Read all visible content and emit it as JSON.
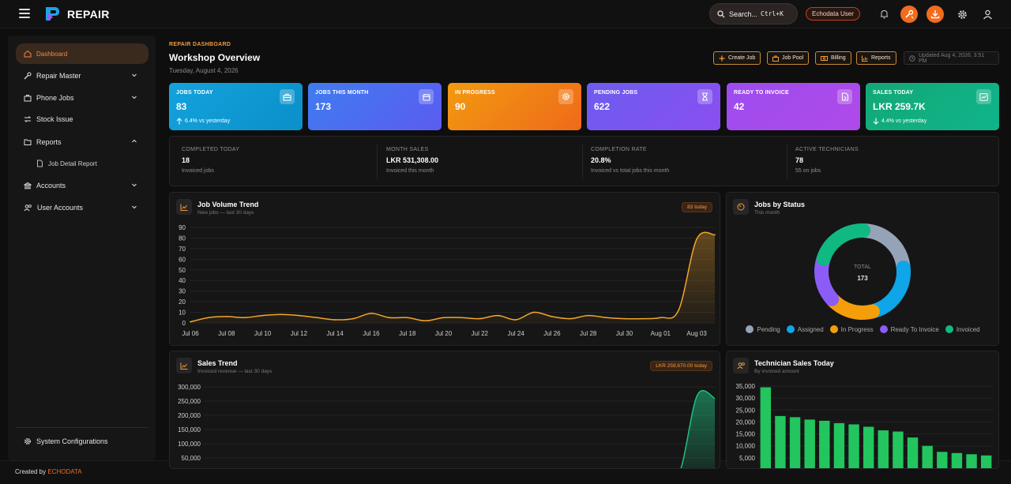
{
  "app": {
    "brand": "REPAIR"
  },
  "topbar": {
    "search_label": "Search...",
    "search_shortcut": "Ctrl+K",
    "user": "Echodata User"
  },
  "sidebar": {
    "items": [
      {
        "label": "Dashboard",
        "icon": "home-icon",
        "active": true
      },
      {
        "label": "Repair Master",
        "icon": "wrench-icon",
        "chevron": "down"
      },
      {
        "label": "Phone Jobs",
        "icon": "briefcase-icon",
        "chevron": "down"
      },
      {
        "label": "Stock Issue",
        "icon": "swap-icon"
      },
      {
        "label": "Reports",
        "icon": "folder-icon",
        "chevron": "up"
      },
      {
        "label": "Job Detail Report",
        "icon": "document-icon",
        "sub": true
      },
      {
        "label": "Accounts",
        "icon": "bank-icon",
        "chevron": "down"
      },
      {
        "label": "User Accounts",
        "icon": "users-icon",
        "chevron": "down"
      }
    ],
    "footer_item": {
      "label": "System Configurations",
      "icon": "gear-icon"
    }
  },
  "footer": {
    "prefix": "Created by",
    "company": "ECHODATA"
  },
  "header": {
    "eyebrow": "REPAIR DASHBOARD",
    "title": "Workshop Overview",
    "date": "Tuesday, August 4, 2026",
    "actions": [
      {
        "label": "Create Job",
        "icon": "plus-icon"
      },
      {
        "label": "Job Pool",
        "icon": "briefcase-icon"
      },
      {
        "label": "Billing",
        "icon": "cash-icon"
      },
      {
        "label": "Reports",
        "icon": "bar-chart-icon"
      }
    ],
    "updated": "Updated Aug 4, 2026, 3:51 PM"
  },
  "kpis": [
    {
      "label": "JOBS TODAY",
      "value": "83",
      "sub": "6.4% vs yesterday",
      "trend": "up",
      "icon": "briefcase-icon",
      "color_from": "#13a3dd",
      "color_to": "#0b8fc8"
    },
    {
      "label": "JOBS THIS MONTH",
      "value": "173",
      "sub": "",
      "icon": "calendar-icon",
      "color_from": "#3f7cf0",
      "color_to": "#5b5cf0"
    },
    {
      "label": "IN PROGRESS",
      "value": "90",
      "sub": "",
      "icon": "gear-icon",
      "color_from": "#f29a10",
      "color_to": "#ef6a1a"
    },
    {
      "label": "PENDING JOBS",
      "value": "622",
      "sub": "",
      "icon": "hourglass-icon",
      "color_from": "#6c5cf0",
      "color_to": "#8a4ff0"
    },
    {
      "label": "READY TO INVOICE",
      "value": "42",
      "sub": "",
      "icon": "invoice-icon",
      "color_from": "#9c4cf0",
      "color_to": "#b04ae8"
    },
    {
      "label": "SALES TODAY",
      "value": "LKR 259.7K",
      "sub": "4.4% vs yesterday",
      "trend": "down",
      "icon": "chart-icon",
      "color_from": "#12a877",
      "color_to": "#10b48a"
    }
  ],
  "summary": [
    {
      "label": "COMPLETED TODAY",
      "value": "18",
      "sub": "Invoiced jobs"
    },
    {
      "label": "MONTH SALES",
      "value": "LKR 531,308.00",
      "sub": "Invoiced this month"
    },
    {
      "label": "COMPLETION RATE",
      "value": "20.8%",
      "sub": "Invoiced vs total jobs this month"
    },
    {
      "label": "ACTIVE TECHNICIANS",
      "value": "78",
      "sub": "55 on jobs"
    }
  ],
  "panels": {
    "job_volume": {
      "title": "Job Volume Trend",
      "subtitle": "New jobs — last 30 days",
      "badge": "83 today"
    },
    "status": {
      "title": "Jobs by Status",
      "subtitle": "This month",
      "center_label": "TOTAL",
      "center_value": "173"
    },
    "sales": {
      "title": "Sales Trend",
      "subtitle": "Invoiced revenue — last 30 days",
      "badge": "LKR 259,670.00 today"
    },
    "tech": {
      "title": "Technician Sales Today",
      "subtitle": "By invoiced amount"
    }
  },
  "colors": {
    "accent": "#f36b1c",
    "line": "#f2a52a",
    "sales_line": "#1fbf80",
    "bar": "#22c55e"
  },
  "chart_data": [
    {
      "type": "area",
      "title": "Job Volume Trend",
      "xlabel": "",
      "ylabel": "",
      "ylim": [
        0,
        90
      ],
      "yticks": [
        0,
        10,
        20,
        30,
        40,
        50,
        60,
        70,
        80,
        90
      ],
      "x_tick_labels": [
        "Jul 06",
        "Jul 08",
        "Jul 10",
        "Jul 12",
        "Jul 14",
        "Jul 16",
        "Jul 18",
        "Jul 20",
        "Jul 22",
        "Jul 24",
        "Jul 26",
        "Jul 28",
        "Jul 30",
        "Aug 01",
        "Aug 03"
      ],
      "x": [
        "Jul 06",
        "Jul 07",
        "Jul 08",
        "Jul 09",
        "Jul 10",
        "Jul 11",
        "Jul 12",
        "Jul 13",
        "Jul 14",
        "Jul 15",
        "Jul 16",
        "Jul 17",
        "Jul 18",
        "Jul 19",
        "Jul 20",
        "Jul 21",
        "Jul 22",
        "Jul 23",
        "Jul 24",
        "Jul 25",
        "Jul 26",
        "Jul 27",
        "Jul 28",
        "Jul 29",
        "Jul 30",
        "Jul 31",
        "Aug 01",
        "Aug 02",
        "Aug 03",
        "Aug 04"
      ],
      "values": [
        1,
        5,
        6,
        5,
        7,
        8,
        7,
        5,
        3,
        4,
        9,
        5,
        5,
        2,
        5,
        5,
        4,
        7,
        3,
        10,
        6,
        4,
        7,
        5,
        4,
        4,
        5,
        12,
        79,
        83
      ]
    },
    {
      "type": "pie",
      "title": "Jobs by Status",
      "categories": [
        "Pending",
        "Assigned",
        "In Progress",
        "Ready To Invoice",
        "Invoiced"
      ],
      "values": [
        39,
        39,
        30,
        29,
        36
      ],
      "colors": [
        "#94a3b8",
        "#0ea5e9",
        "#f59e0b",
        "#8b5cf6",
        "#10b981"
      ],
      "legend": "bottom"
    },
    {
      "type": "area",
      "title": "Sales Trend",
      "ylim": [
        0,
        300000
      ],
      "yticks": [
        50000,
        100000,
        150000,
        200000,
        250000,
        300000
      ],
      "ytick_labels": [
        "50,000",
        "100,000",
        "150,000",
        "200,000",
        "250,000",
        "300,000"
      ],
      "values": [
        0,
        0,
        0,
        0,
        0,
        0,
        0,
        0,
        0,
        0,
        0,
        0,
        0,
        0,
        0,
        0,
        0,
        0,
        0,
        0,
        0,
        0,
        0,
        0,
        0,
        0,
        0,
        0,
        270000,
        259670
      ]
    },
    {
      "type": "bar",
      "title": "Technician Sales Today",
      "ylim": [
        0,
        35000
      ],
      "yticks": [
        5000,
        10000,
        15000,
        20000,
        25000,
        30000,
        35000
      ],
      "ytick_labels": [
        "5,000",
        "10,000",
        "15,000",
        "20,000",
        "25,000",
        "30,000",
        "35,000"
      ],
      "values": [
        34500,
        22500,
        22000,
        21000,
        20500,
        19500,
        19000,
        18000,
        16500,
        16000,
        13500,
        10000,
        7500,
        7000,
        6500,
        6000
      ]
    }
  ]
}
